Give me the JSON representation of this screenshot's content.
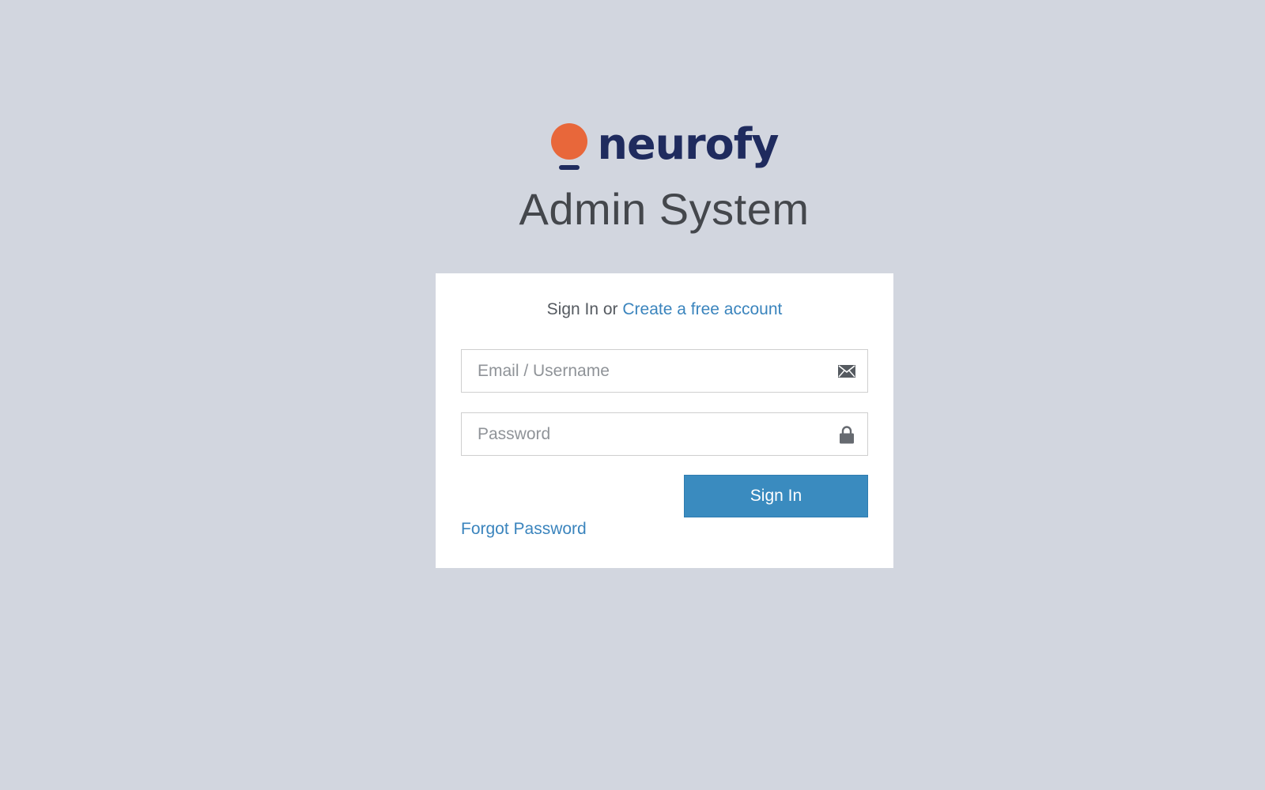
{
  "brand": {
    "name": "neurofy",
    "subtitle": "Admin System",
    "colors": {
      "logo_dot": "#e8673a",
      "logo_text": "#1f2b5e"
    }
  },
  "login": {
    "heading_prefix": "Sign In or ",
    "create_account_label": "Create a free account",
    "email_placeholder": "Email / Username",
    "email_value": "",
    "email_icon": "envelope-icon",
    "password_placeholder": "Password",
    "password_value": "",
    "password_icon": "lock-icon",
    "sign_in_label": "Sign In",
    "forgot_password_label": "Forgot Password"
  },
  "colors": {
    "background": "#d2d6df",
    "card": "#ffffff",
    "accent": "#3a8bbf",
    "link": "#3a84bd"
  }
}
